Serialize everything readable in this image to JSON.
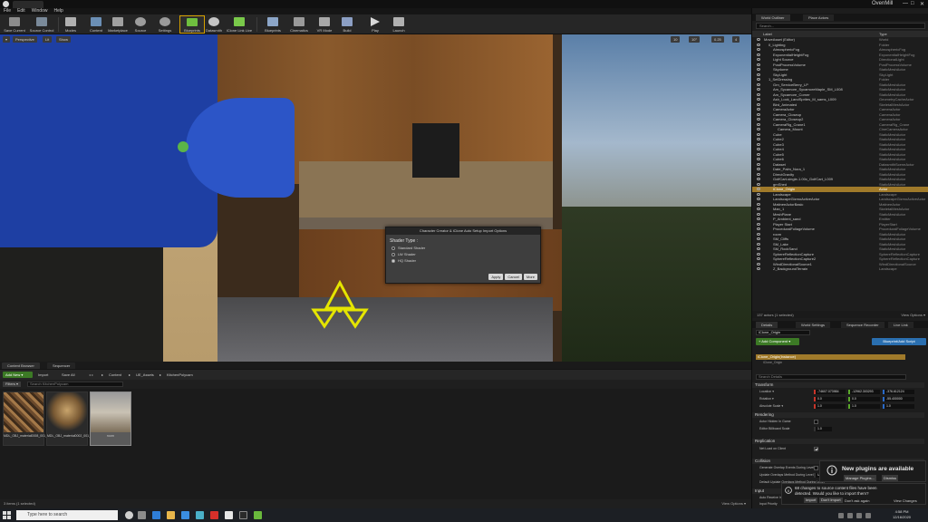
{
  "titlebar": {
    "app_title": "OvenMill",
    "min": "—",
    "max": "□",
    "close": "✕"
  },
  "menu": [
    "File",
    "Edit",
    "Window",
    "Help"
  ],
  "toolbar": [
    {
      "label": "Save Current",
      "icon": "save-icon"
    },
    {
      "label": "Source Control",
      "icon": "source-control-icon"
    },
    {
      "label": "Modes",
      "icon": "modes-icon"
    },
    {
      "label": "Content",
      "icon": "content-icon"
    },
    {
      "label": "Marketplace",
      "icon": "marketplace-icon"
    },
    {
      "label": "Source",
      "icon": "source-icon"
    },
    {
      "label": "Settings",
      "icon": "gear-icon"
    },
    {
      "label": "Blueprints",
      "icon": "blueprint-icon"
    },
    {
      "label": "Datasmith",
      "icon": "datasmith-icon"
    },
    {
      "label": "iClone Link Live",
      "icon": "iclone-link-icon"
    },
    {
      "label": "Blueprints",
      "icon": "blueprints-icon"
    },
    {
      "label": "Cinematics",
      "icon": "cinematics-icon"
    },
    {
      "label": "VR Mode",
      "icon": "vr-icon"
    },
    {
      "label": "Build",
      "icon": "build-icon"
    },
    {
      "label": "Play",
      "icon": "play-icon"
    },
    {
      "label": "Launch",
      "icon": "launch-icon"
    }
  ],
  "viewport": {
    "perspective": "Perspective",
    "lit": "Lit",
    "show": "Show",
    "snap": "10",
    "angle": "10°",
    "scale": "0.25",
    "cam": "4"
  },
  "dialog": {
    "title": "Character Creator & iClone Auto Setup Import Options",
    "heading": "Shader Type :",
    "options": [
      {
        "label": "Standard Shader",
        "selected": false
      },
      {
        "label": "LW Shader",
        "selected": false
      },
      {
        "label": "HQ Shader",
        "selected": true
      }
    ],
    "buttons": [
      "Apply",
      "Cancel",
      "More"
    ]
  },
  "bottom_tabs": [
    "Content Browser",
    "Sequencer"
  ],
  "content_browser": {
    "add_new": "Add New ▾",
    "import": "Import",
    "save_all": "Save All",
    "path": [
      "Content",
      "UE_Assets",
      "KitchenPolycam"
    ],
    "filters": "Filters ▾",
    "search_placeholder": "Search KitchenPolycam",
    "assets": [
      {
        "name": "MDL_OBJ_material0008_001_0b_pbr_Diffuse"
      },
      {
        "name": "MDL_OBJ_material0002_001_baked"
      },
      {
        "name": "room"
      }
    ],
    "status": "3 items (1 selected)",
    "view_options": "View Options ▾"
  },
  "outliner": {
    "tabs": [
      "World Outliner",
      "Place Actors"
    ],
    "search_placeholder": "Search...",
    "col_label": "Label",
    "col_type": "Type",
    "rows": [
      {
        "name": "MoveAsset (Editor)",
        "type": "World",
        "indent": 0
      },
      {
        "name": "0_Lighting",
        "type": "Folder",
        "indent": 1
      },
      {
        "name": "AtmosphericFog",
        "type": "AtmosphericFog",
        "indent": 2
      },
      {
        "name": "ExponentialHeightFog",
        "type": "ExponentialHeightFog",
        "indent": 2
      },
      {
        "name": "Light Source",
        "type": "DirectionalLight",
        "indent": 2
      },
      {
        "name": "PostProcessVolume",
        "type": "PostProcessVolume",
        "indent": 2
      },
      {
        "name": "Skydome",
        "type": "StaticMeshActor",
        "indent": 2
      },
      {
        "name": "SkyLight",
        "type": "SkyLight",
        "indent": 2
      },
      {
        "name": "1_SetDressing",
        "type": "Folder",
        "indent": 1
      },
      {
        "name": "Grn_ServiceBerry_LP",
        "type": "StaticMeshActor",
        "indent": 2
      },
      {
        "name": "Am_Sycamore_SycamoreMaple_SM_L008",
        "type": "StaticMeshActor",
        "indent": 2
      },
      {
        "name": "Am_Sycamore_Corner",
        "type": "StaticMeshActor",
        "indent": 2
      },
      {
        "name": "Ash_Lock_LandSprites_M_sams_L009",
        "type": "GeometryCacheActor",
        "indent": 2
      },
      {
        "name": "Bird_Animated",
        "type": "SkeletalMeshActor",
        "indent": 2
      },
      {
        "name": "CameraActor",
        "type": "CameraActor",
        "indent": 2
      },
      {
        "name": "Camera_Closeup",
        "type": "CameraActor",
        "indent": 2
      },
      {
        "name": "Camera_Closeup2",
        "type": "CameraActor",
        "indent": 2
      },
      {
        "name": "CameraRig_Crane1",
        "type": "CameraRig_Crane",
        "indent": 2
      },
      {
        "name": "Camera_Mount",
        "type": "CineCameraActor",
        "indent": 3
      },
      {
        "name": "Cube",
        "type": "StaticMeshActor",
        "indent": 2
      },
      {
        "name": "Cube2",
        "type": "StaticMeshActor",
        "indent": 2
      },
      {
        "name": "Cube3",
        "type": "StaticMeshActor",
        "indent": 2
      },
      {
        "name": "Cube4",
        "type": "StaticMeshActor",
        "indent": 2
      },
      {
        "name": "Cube5",
        "type": "StaticMeshActor",
        "indent": 2
      },
      {
        "name": "Cube6",
        "type": "StaticMeshActor",
        "indent": 2
      },
      {
        "name": "Dataset",
        "type": "DatasmithSceneActor",
        "indent": 2
      },
      {
        "name": "Date_Palm_Nora_1",
        "type": "StaticMeshActor",
        "indent": 2
      },
      {
        "name": "DirectGravity",
        "type": "StaticMeshActor",
        "indent": 2
      },
      {
        "name": "GolfCart-single-1.00x_GolfCart_L009",
        "type": "StaticMeshActor",
        "indent": 2
      },
      {
        "name": "grnShed",
        "type": "StaticMeshActor",
        "indent": 2
      },
      {
        "name": "iClone_Origin",
        "type": "Actor",
        "indent": 2,
        "selected": true
      },
      {
        "name": "Landscape",
        "type": "Landscape",
        "indent": 2
      },
      {
        "name": "LandscapeGizmoActiveActor",
        "type": "LandscapeGizmoActiveActor",
        "indent": 2
      },
      {
        "name": "MatineeActorBasic",
        "type": "MatineeActor",
        "indent": 2
      },
      {
        "name": "Man_1",
        "type": "SkeletalMeshActor",
        "indent": 2
      },
      {
        "name": "MeshPlane",
        "type": "StaticMeshActor",
        "indent": 2
      },
      {
        "name": "P_Ambient_sand",
        "type": "Emitter",
        "indent": 2
      },
      {
        "name": "Player Start",
        "type": "PlayerStart",
        "indent": 2
      },
      {
        "name": "ProceduralFoliageVolume",
        "type": "ProceduralFoliageVolume",
        "indent": 2
      },
      {
        "name": "room",
        "type": "StaticMeshActor",
        "indent": 2
      },
      {
        "name": "SM_Cliffs",
        "type": "StaticMeshActor",
        "indent": 2
      },
      {
        "name": "SM_Lake",
        "type": "StaticMeshActor",
        "indent": 2
      },
      {
        "name": "SM_RockSand",
        "type": "StaticMeshActor",
        "indent": 2
      },
      {
        "name": "SphereReflectionCapture",
        "type": "SphereReflectionCapture",
        "indent": 2
      },
      {
        "name": "SphereReflectionCapture2",
        "type": "SphereReflectionCapture",
        "indent": 2
      },
      {
        "name": "WindDirectionalSource1",
        "type": "WindDirectionalSource",
        "indent": 2
      },
      {
        "name": "Z_BackgroundTerrain",
        "type": "Landscape",
        "indent": 2
      }
    ],
    "footer": "137 actors (1 selected)",
    "view_options": "View Options ▾"
  },
  "details": {
    "tabs": [
      "Details",
      "World Settings",
      "Sequence Recorder",
      "Live Link"
    ],
    "actor_name": "iClone_Origin",
    "add_component": "+ Add Component ▾",
    "blueprint_btn": "Blueprint/Add Script",
    "component_selected": "iClone_Origin(Instance)",
    "component_sub": "iClone_Origin",
    "search_placeholder": "Search Details",
    "sections": {
      "transform": "Transform",
      "rendering": "Rendering",
      "replication": "Replication",
      "collision": "Collision",
      "input": "Input"
    },
    "transform": {
      "location_label": "Location ▾",
      "location": [
        "-74607.073984",
        "-12962.303293",
        "-376.612124"
      ],
      "rotation_label": "Rotation ▾",
      "rotation": [
        "0.0",
        "0.0",
        "-55.400000"
      ],
      "scale_label": "Absolute Scale ▾",
      "scale": [
        "1.0",
        "1.0",
        "1.0"
      ]
    },
    "rendering": {
      "actor_hidden": "Actor Hidden In Game",
      "billboard": "Editor Billboard Scale",
      "billboard_value": "1.0"
    },
    "replication": {
      "net_load": "Net Load on Client"
    },
    "collision": {
      "gen_overlap": "Generate Overlap Events During Level",
      "update_overlap": "Update Overlaps Method During Level",
      "update_value": "Use",
      "default_update": "Default Update Overlaps Method During Level"
    },
    "input": {
      "auto_receive": "Auto Receive Input",
      "input_priority": "Input Priority"
    }
  },
  "notifications": {
    "plugins_title": "New plugins are available",
    "manage_plugins": "Manage Plugins...",
    "dismiss": "Dismiss",
    "changes_msg": "68 changes to source content files have been detected. Would you like to import them?",
    "import": "Import",
    "dont_import": "Don't Import",
    "dont_ask": "Don't ask again",
    "view_changes": "View Changes"
  },
  "taskbar": {
    "search_placeholder": "Type here to search",
    "time": "4:58 PM",
    "date": "12/16/2020"
  }
}
